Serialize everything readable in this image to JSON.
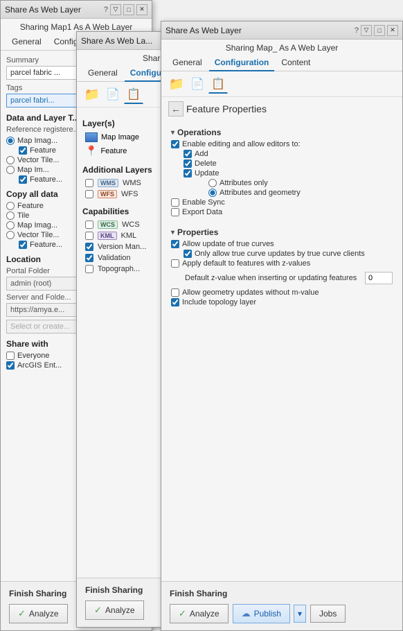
{
  "window1": {
    "title": "Share As Web Layer",
    "subtitle": "Sharing Map1 As A Web Layer",
    "controls": [
      "?",
      "▽",
      "□",
      "✕"
    ],
    "tabs": [
      {
        "label": "General",
        "active": false
      },
      {
        "label": "Configu...",
        "active": false
      }
    ],
    "summary_label": "Summary",
    "summary_value": "parcel fabric ...",
    "tags_label": "Tags",
    "tags_value": "parcel fabri...",
    "section_data_layer": "Data and Layer T...",
    "ref_registered": "Reference registere...",
    "options": [
      {
        "label": "Map Imag...",
        "checked": true
      },
      {
        "label": "Feature",
        "checked": true
      },
      {
        "label": "Vector Tile...",
        "checked": false
      },
      {
        "label": "Map Im...",
        "checked": false
      }
    ],
    "copy_all_data": "Copy all data",
    "copy_options": [
      {
        "label": "Feature",
        "selected": false
      },
      {
        "label": "Tile",
        "selected": false
      },
      {
        "label": "Map Imag...",
        "selected": false
      },
      {
        "label": "Vector Tile...",
        "selected": false
      },
      {
        "label": "Feature...",
        "selected": false
      }
    ],
    "location": "Location",
    "portal_folder": "Portal Folder",
    "portal_value": "admin (root)",
    "server_folder": "Server and Folde...",
    "server_value": "https://amya.e...",
    "select_placeholder": "Select or create...",
    "share_with": "Share with",
    "share_options": [
      {
        "label": "Everyone",
        "checked": false
      },
      {
        "label": "ArcGIS Ent...",
        "checked": true
      }
    ],
    "finish_sharing": "Finish Sharing",
    "analyze_label": "Analyze"
  },
  "window2": {
    "title": "Share As Web La...",
    "subtitle": "Shari...",
    "controls": [
      "?",
      "▽",
      "□",
      "✕"
    ],
    "tabs": [
      {
        "label": "General",
        "active": false
      },
      {
        "label": "Configura...",
        "active": true
      }
    ],
    "layers_section": "Layer(s)",
    "layers": [
      {
        "label": "Map Image",
        "type": "map"
      },
      {
        "label": "Feature",
        "type": "feature"
      }
    ],
    "additional_layers": "Additional Layers",
    "additional": [
      {
        "label": "WMS",
        "checked": false
      },
      {
        "label": "WFS",
        "checked": false
      }
    ],
    "capabilities": "Capabilities",
    "capability_items": [
      {
        "label": "WCS",
        "checked": false
      },
      {
        "label": "KML",
        "checked": false
      },
      {
        "label": "Version Man...",
        "checked": true
      },
      {
        "label": "Validation",
        "checked": true
      },
      {
        "label": "Topograph...",
        "checked": false
      }
    ],
    "finish_sharing": "Finish Sharing",
    "analyze_label": "Analyze"
  },
  "window3": {
    "title": "Share As Web Layer",
    "subtitle": "Sharing Map_ As A Web Layer",
    "controls": [
      "?",
      "▽",
      "□",
      "✕"
    ],
    "tabs": [
      {
        "label": "General",
        "active": false
      },
      {
        "label": "Configuration",
        "active": true
      },
      {
        "label": "Content",
        "active": false
      }
    ],
    "page_title": "Feature Properties",
    "operations_section": "Operations",
    "enable_editing": "Enable editing and allow editors to:",
    "editing_options": [
      {
        "label": "Add",
        "checked": true
      },
      {
        "label": "Delete",
        "checked": true
      },
      {
        "label": "Update",
        "checked": true
      }
    ],
    "update_sub_options": [
      {
        "label": "Attributes only",
        "selected": false
      },
      {
        "label": "Attributes and geometry",
        "selected": true
      }
    ],
    "sync_options": [
      {
        "label": "Enable Sync",
        "checked": false
      },
      {
        "label": "Export Data",
        "checked": false
      }
    ],
    "properties_section": "Properties",
    "prop_options": [
      {
        "label": "Allow update of true curves",
        "checked": true
      },
      {
        "label": "Only allow true curve updates by true curve clients",
        "checked": true,
        "indented": true
      },
      {
        "label": "Apply default to features with z-values",
        "checked": false
      }
    ],
    "z_value_label": "Default z-value when inserting or updating features",
    "z_value": "0",
    "more_options": [
      {
        "label": "Allow geometry updates without m-value",
        "checked": false
      },
      {
        "label": "Include topology layer",
        "checked": true
      }
    ],
    "finish_sharing": "Finish Sharing",
    "analyze_label": "Analyze",
    "publish_label": "Publish",
    "jobs_label": "Jobs"
  }
}
